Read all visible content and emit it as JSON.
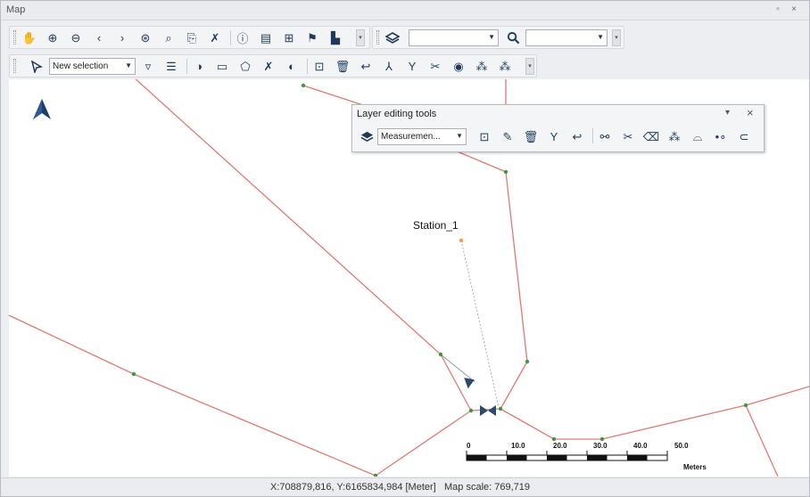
{
  "window": {
    "title": "Map",
    "restore_glyph": "▫",
    "close_glyph": "×"
  },
  "toolbar1": {
    "buttons": [
      {
        "name": "pan-icon",
        "glyph": "✋"
      },
      {
        "name": "zoom-in-icon",
        "glyph": "⊕"
      },
      {
        "name": "zoom-out-icon",
        "glyph": "⊖"
      },
      {
        "name": "back-icon",
        "glyph": "‹"
      },
      {
        "name": "forward-icon",
        "glyph": "›"
      },
      {
        "name": "full-extent-icon",
        "glyph": "⊛"
      },
      {
        "name": "zoom-to-selection-icon",
        "glyph": "⌕"
      },
      {
        "name": "copy-map-icon",
        "glyph": "⎘"
      },
      {
        "name": "clear-selection-icon",
        "glyph": "✗"
      },
      {
        "name": "info-icon",
        "glyph": "ⓘ"
      },
      {
        "name": "table-icon",
        "glyph": "▤"
      },
      {
        "name": "grid-icon",
        "glyph": "⊞"
      },
      {
        "name": "flag-icon",
        "glyph": "⚑"
      },
      {
        "name": "chart-icon",
        "glyph": "▙"
      }
    ],
    "layers_icon": "layers-icon",
    "layer_combo_value": "",
    "search_icon": "search-icon",
    "search_combo_value": ""
  },
  "toolbar2": {
    "select_icon": "pointer-icon",
    "selection_combo_value": "New selection",
    "buttons": [
      {
        "name": "filter-select-icon",
        "glyph": "▿"
      },
      {
        "name": "list-icon",
        "glyph": "☰"
      },
      {
        "name": "mouse-icon",
        "glyph": "◑"
      },
      {
        "name": "rectangle-icon",
        "glyph": "▭"
      },
      {
        "name": "polygon-icon",
        "glyph": "⬠"
      },
      {
        "name": "deselect-icon",
        "glyph": "✗"
      },
      {
        "name": "invert-icon",
        "glyph": "◐"
      },
      {
        "name": "new-feature-icon",
        "glyph": "⊡"
      },
      {
        "name": "delete-icon",
        "glyph": "🗑"
      },
      {
        "name": "undo-icon",
        "glyph": "↩"
      },
      {
        "name": "split-icon",
        "glyph": "⅄"
      },
      {
        "name": "merge-icon",
        "glyph": "Y"
      },
      {
        "name": "scissors-icon",
        "glyph": "✂"
      },
      {
        "name": "toggle-icon",
        "glyph": "◉"
      },
      {
        "name": "vertex-icon",
        "glyph": "⁂"
      },
      {
        "name": "vertex-edit-icon",
        "glyph": "⁂"
      }
    ]
  },
  "layer_editing": {
    "title": "Layer editing tools",
    "pin_glyph": "▾",
    "close_glyph": "×",
    "layer_combo_value": "Measuremen...",
    "buttons": [
      {
        "name": "new-feature-icon",
        "glyph": "⊡"
      },
      {
        "name": "pencil-icon",
        "glyph": "✎"
      },
      {
        "name": "delete-icon",
        "glyph": "🗑"
      },
      {
        "name": "merge-icon",
        "glyph": "Y"
      },
      {
        "name": "undo-icon",
        "glyph": "↩"
      },
      {
        "name": "link-icon",
        "glyph": "⚯"
      },
      {
        "name": "scissors-icon",
        "glyph": "✂"
      },
      {
        "name": "eraser-icon",
        "glyph": "⌫"
      },
      {
        "name": "vertex-icon",
        "glyph": "⁂"
      },
      {
        "name": "dome-icon",
        "glyph": "⌓"
      },
      {
        "name": "dots-icon",
        "glyph": "•∘"
      },
      {
        "name": "toggle-icon",
        "glyph": "⊂"
      }
    ]
  },
  "map": {
    "north_arrow_icon": "north-arrow-icon",
    "station_label": "Station_1",
    "scalebar": {
      "ticks": [
        "0",
        "10.0",
        "20.0",
        "30.0",
        "40.0",
        "50.0"
      ],
      "unit": "Meters"
    },
    "colors": {
      "line": "#e07a74",
      "node": "#3c9a3c",
      "station": "#f0a040",
      "symbol": "#2a4a70"
    }
  },
  "status": {
    "coords": "X:708879,816, Y:6165834,984 [Meter]",
    "scale": "Map scale: 769,719"
  }
}
